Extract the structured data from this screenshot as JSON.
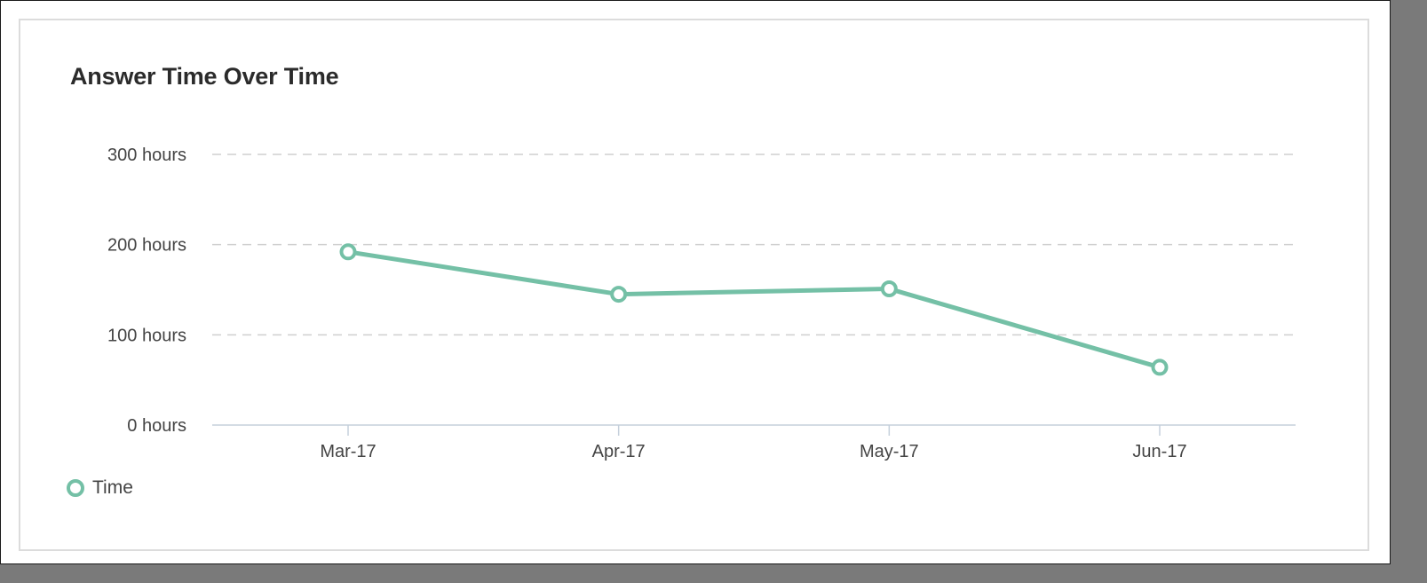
{
  "chart_data": {
    "type": "line",
    "title": "Answer Time Over Time",
    "xlabel": "",
    "ylabel": "",
    "categories": [
      "Mar-17",
      "Apr-17",
      "May-17",
      "Jun-17"
    ],
    "series": [
      {
        "name": "Time",
        "values": [
          192,
          145,
          151,
          64
        ],
        "color": "#74c0a6"
      }
    ],
    "yticks": [
      {
        "value": 0,
        "label": "0 hours"
      },
      {
        "value": 100,
        "label": "100 hours"
      },
      {
        "value": 200,
        "label": "200 hours"
      },
      {
        "value": 300,
        "label": "300 hours"
      }
    ],
    "ylim": [
      0,
      300
    ],
    "grid": true,
    "legend_position": "bottom-left"
  }
}
